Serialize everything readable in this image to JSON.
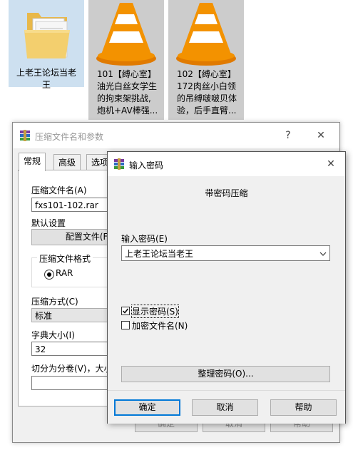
{
  "desktop": {
    "files": [
      {
        "label": "上老王论坛当老\n王",
        "icon": "folder-icon"
      },
      {
        "label": "101【缚心室】\n油光白丝女学生\n的拘束架挑战,\n炮机+AV棒强...",
        "icon": "vlc-cone-icon"
      },
      {
        "label": "102【缚心室】\n172肉丝小白领\n的吊缚啵啵贝体\n验，后手直臂...",
        "icon": "vlc-cone-icon"
      }
    ]
  },
  "main_dialog": {
    "title": "压缩文件名和参数",
    "help": "?",
    "close": "✕",
    "tabs": [
      "常规",
      "高级",
      "选项"
    ],
    "archive_name_label": "压缩文件名(A)",
    "archive_name_value": "fxs101-102.rar",
    "defaults_label": "默认设置",
    "profiles_button": "配置文件(F)",
    "format_group_label": "压缩文件格式",
    "format_rar": "RAR",
    "method_label": "压缩方式(C)",
    "method_value": "标准",
    "dict_label": "字典大小(I)",
    "dict_value": "32",
    "split_label": "切分为分卷(V)，大小",
    "ok_button": "确定",
    "cancel_button": "取消",
    "help_button": "帮助"
  },
  "pw_dialog": {
    "title": "输入密码",
    "close": "✕",
    "heading": "带密码压缩",
    "enter_label": "输入密码(E)",
    "password_value": "上老王论坛当老王",
    "show_password_label": "显示密码(S)",
    "show_password_checked": true,
    "encrypt_names_label": "加密文件名(N)",
    "encrypt_names_checked": false,
    "organize_button": "整理密码(O)...",
    "ok_button": "确定",
    "cancel_button": "取消",
    "help_button": "帮助"
  },
  "colors": {
    "selection_blue": "#cde0f0",
    "selection_gray": "#cccccc",
    "accent": "#0078d7",
    "vlc_orange": "#f08a00"
  }
}
